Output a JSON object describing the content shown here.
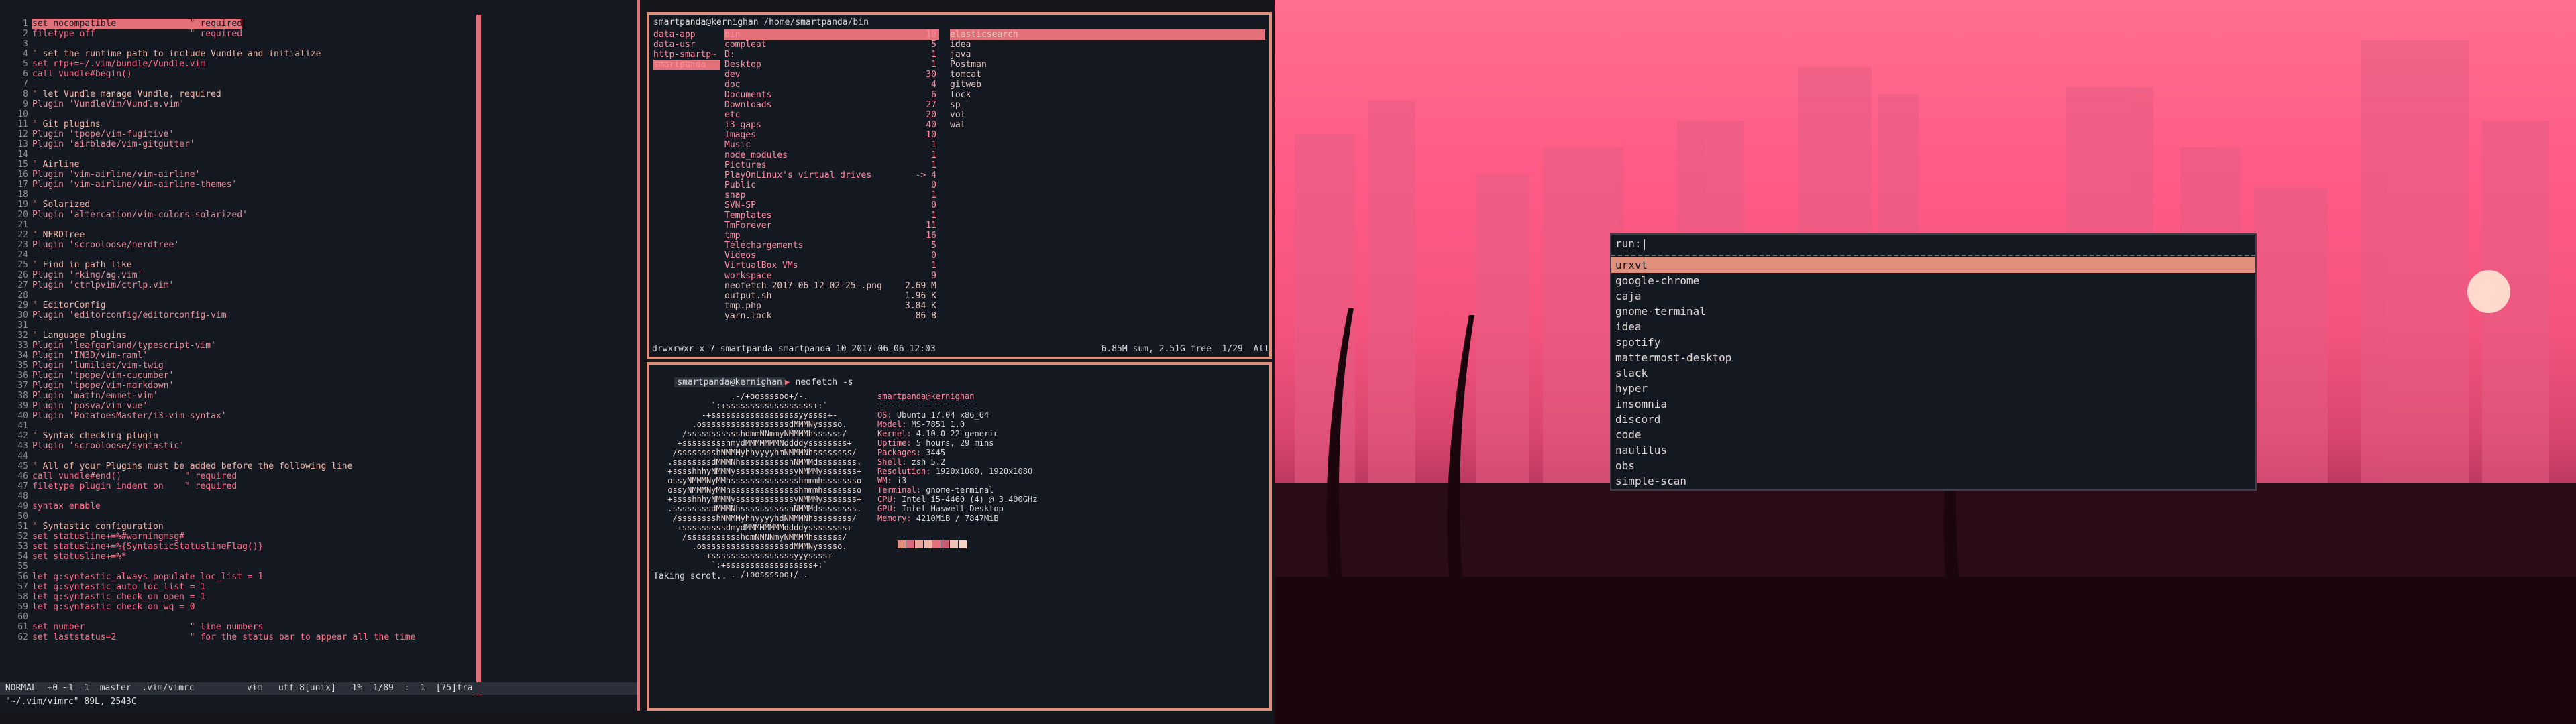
{
  "vim": {
    "lines": [
      {
        "n": "1",
        "t": "set nocompatible              \" required"
      },
      {
        "n": "2",
        "t": "filetype off                  \" required"
      },
      {
        "n": "3",
        "t": ""
      },
      {
        "n": "4",
        "t": "\" set the runtime path to include Vundle and initialize"
      },
      {
        "n": "5",
        "t": "set rtp+=~/.vim/bundle/Vundle.vim"
      },
      {
        "n": "6",
        "t": "call vundle#begin()"
      },
      {
        "n": "7",
        "t": ""
      },
      {
        "n": "8",
        "t": "\" let Vundle manage Vundle, required"
      },
      {
        "n": "9",
        "t": "Plugin 'VundleVim/Vundle.vim'"
      },
      {
        "n": "10",
        "t": ""
      },
      {
        "n": "11",
        "t": "\" Git plugins"
      },
      {
        "n": "12",
        "t": "Plugin 'tpope/vim-fugitive'"
      },
      {
        "n": "13",
        "t": "Plugin 'airblade/vim-gitgutter'"
      },
      {
        "n": "14",
        "t": ""
      },
      {
        "n": "15",
        "t": "\" Airline"
      },
      {
        "n": "16",
        "t": "Plugin 'vim-airline/vim-airline'"
      },
      {
        "n": "17",
        "t": "Plugin 'vim-airline/vim-airline-themes'"
      },
      {
        "n": "18",
        "t": ""
      },
      {
        "n": "19",
        "t": "\" Solarized"
      },
      {
        "n": "20",
        "t": "Plugin 'altercation/vim-colors-solarized'"
      },
      {
        "n": "21",
        "t": ""
      },
      {
        "n": "22",
        "t": "\" NERDTree"
      },
      {
        "n": "23",
        "t": "Plugin 'scrooloose/nerdtree'"
      },
      {
        "n": "24",
        "t": ""
      },
      {
        "n": "25",
        "t": "\" Find in path like"
      },
      {
        "n": "26",
        "t": "Plugin 'rking/ag.vim'"
      },
      {
        "n": "27",
        "t": "Plugin 'ctrlpvim/ctrlp.vim'"
      },
      {
        "n": "28",
        "t": ""
      },
      {
        "n": "29",
        "t": "\" EditorConfig"
      },
      {
        "n": "30",
        "t": "Plugin 'editorconfig/editorconfig-vim'"
      },
      {
        "n": "31",
        "t": ""
      },
      {
        "n": "32",
        "t": "\" Language plugins"
      },
      {
        "n": "33",
        "t": "Plugin 'leafgarland/typescript-vim'"
      },
      {
        "n": "34",
        "t": "Plugin 'IN3D/vim-raml'"
      },
      {
        "n": "35",
        "t": "Plugin 'lumiliet/vim-twig'"
      },
      {
        "n": "36",
        "t": "Plugin 'tpope/vim-cucumber'"
      },
      {
        "n": "37",
        "t": "Plugin 'tpope/vim-markdown'"
      },
      {
        "n": "38",
        "t": "Plugin 'mattn/emmet-vim'"
      },
      {
        "n": "39",
        "t": "Plugin 'posva/vim-vue'"
      },
      {
        "n": "40",
        "t": "Plugin 'PotatoesMaster/i3-vim-syntax'"
      },
      {
        "n": "41",
        "t": ""
      },
      {
        "n": "42",
        "t": "\" Syntax checking plugin"
      },
      {
        "n": "43",
        "t": "Plugin 'scrooloose/syntastic'"
      },
      {
        "n": "44",
        "t": ""
      },
      {
        "n": "45",
        "t": "\" All of your Plugins must be added before the following line"
      },
      {
        "n": "46",
        "t": "call vundle#end()            \" required"
      },
      {
        "n": "47",
        "t": "filetype plugin indent on    \" required"
      },
      {
        "n": "48",
        "t": ""
      },
      {
        "n": "49",
        "t": "syntax enable"
      },
      {
        "n": "50",
        "t": ""
      },
      {
        "n": "51",
        "t": "\" Syntastic configuration"
      },
      {
        "n": "52",
        "t": "set statusline+=%#warningmsg#"
      },
      {
        "n": "53",
        "t": "set statusline+=%{SyntasticStatuslineFlag()}"
      },
      {
        "n": "54",
        "t": "set statusline+=%*"
      },
      {
        "n": "55",
        "t": ""
      },
      {
        "n": "56",
        "t": "let g:syntastic_always_populate_loc_list = 1"
      },
      {
        "n": "57",
        "t": "let g:syntastic_auto_loc_list = 1"
      },
      {
        "n": "58",
        "t": "let g:syntastic_check_on_open = 1"
      },
      {
        "n": "59",
        "t": "let g:syntastic_check_on_wq = 0"
      },
      {
        "n": "60",
        "t": ""
      },
      {
        "n": "61",
        "t": "set number                    \" line numbers"
      },
      {
        "n": "62",
        "t": "set laststatus=2              \" for the status bar to appear all the time"
      }
    ],
    "status": " NORMAL  +0 ~1 -1  master  .vim/vimrc          vim   utf-8[unix]   1%  1/89  :  1  [75]tra",
    "cmdline": "\"~/.vim/vimrc\" 89L, 2543C"
  },
  "ranger": {
    "title": "smartpanda@kernighan /home/smartpanda/bin",
    "col1": [
      "data-app",
      "data-usr",
      "http-smartp~",
      "smartpanda"
    ],
    "col2": [
      {
        "name": "bin",
        "size": "10"
      },
      {
        "name": "compleat",
        "size": "5"
      },
      {
        "name": "D:",
        "size": "1"
      },
      {
        "name": "Desktop",
        "size": "1"
      },
      {
        "name": "dev",
        "size": "30"
      },
      {
        "name": "doc",
        "size": "4"
      },
      {
        "name": "Documents",
        "size": "6"
      },
      {
        "name": "Downloads",
        "size": "27"
      },
      {
        "name": "etc",
        "size": "20"
      },
      {
        "name": "i3-gaps",
        "size": "40"
      },
      {
        "name": "Images",
        "size": "10"
      },
      {
        "name": "Music",
        "size": "1"
      },
      {
        "name": "node_modules",
        "size": "1"
      },
      {
        "name": "Pictures",
        "size": "1"
      },
      {
        "name": "PlayOnLinux's virtual drives",
        "size": "-> 4"
      },
      {
        "name": "Public",
        "size": "0"
      },
      {
        "name": "snap",
        "size": "1"
      },
      {
        "name": "SVN-SP",
        "size": "0"
      },
      {
        "name": "Templates",
        "size": "1"
      },
      {
        "name": "TmForever",
        "size": "11"
      },
      {
        "name": "tmp",
        "size": "16"
      },
      {
        "name": "Téléchargements",
        "size": "5"
      },
      {
        "name": "Videos",
        "size": "0"
      },
      {
        "name": "VirtualBox VMs",
        "size": "1"
      },
      {
        "name": "workspace",
        "size": "9"
      },
      {
        "name": "neofetch-2017-06-12-02-25-.png",
        "size": "2.69 M"
      },
      {
        "name": "output.sh",
        "size": "1.96 K"
      },
      {
        "name": "tmp.php",
        "size": "3.84 K"
      },
      {
        "name": "yarn.lock",
        "size": "86 B"
      }
    ],
    "col3": [
      "elasticsearch",
      "idea",
      "java",
      "Postman",
      "tomcat",
      "gitweb",
      "lock",
      "sp",
      "vol",
      "wal"
    ],
    "footer_left": "drwxrwxr-x 7 smartpanda smartpanda 10 2017-06-06 12:03",
    "footer_right": "6.85M sum, 2.51G free  1/29  All"
  },
  "term": {
    "prompt_user": "smartpanda@kernighan",
    "prompt_cmd": "neofetch -s",
    "logo": [
      "              .-/+oossssoo+/-.",
      "          `:+ssssssssssssssssss+:`",
      "        -+ssssssssssssssssssyyssss+-",
      "      .ossssssssssssssssssdMMMNysssso.",
      "    /ssssssssssshdmmNNmmyNMMMMhssssss/",
      "   +ssssssssshmydMMMMMMMNddddyssssssss+",
      "  /sssssssshNMMMyhhyyyyhmNMMMNhssssssss/",
      " .ssssssssdMMMNhsssssssssshNMMMdssssssss.",
      " +sssshhhyNMMNyssssssssssssyNMMMysssssss+",
      " ossyNMMMNyMMhsssssssssssssshmmmhssssssso",
      " ossyNMMMNyMMhsssssssssssssshmmmhssssssso",
      " +sssshhhyNMMNyssssssssssssyNMMMysssssss+",
      " .ssssssssdMMMNhsssssssssshNMMMdssssssss.",
      "  /sssssssshNMMMyhhyyyyhdNMMMNhssssssss/",
      "   +sssssssssdmydMMMMMMMMddddyssssssss+",
      "    /ssssssssssshdmNNNNmyNMMMMhssssss/",
      "      .ossssssssssssssssssdMMMNysssso.",
      "        -+sssssssssssssssssyyyssss+-",
      "          `:+ssssssssssssssssss+:`",
      "              .-/+oossssoo+/-."
    ],
    "info": [
      {
        "k": "",
        "v": "smartpanda@kernighan"
      },
      {
        "k": "",
        "v": "--------------------"
      },
      {
        "k": "OS:",
        "v": " Ubuntu 17.04 x86_64"
      },
      {
        "k": "Model:",
        "v": " MS-7851 1.0"
      },
      {
        "k": "Kernel:",
        "v": " 4.10.0-22-generic"
      },
      {
        "k": "Uptime:",
        "v": " 5 hours, 29 mins"
      },
      {
        "k": "Packages:",
        "v": " 3445"
      },
      {
        "k": "Shell:",
        "v": " zsh 5.2"
      },
      {
        "k": "Resolution:",
        "v": " 1920x1080, 1920x1080"
      },
      {
        "k": "WM:",
        "v": " i3"
      },
      {
        "k": "Terminal:",
        "v": " gnome-terminal"
      },
      {
        "k": "CPU:",
        "v": " Intel i5-4460 (4) @ 3.400GHz"
      },
      {
        "k": "GPU:",
        "v": " Intel Haswell Desktop"
      },
      {
        "k": "Memory:",
        "v": " 4210MiB / 7847MiB"
      }
    ],
    "swatches": [
      "#e0907a",
      "#d86a7d",
      "#e8a59a",
      "#f0b5a6",
      "#e4707a",
      "#c75d73",
      "#efc2b6",
      "#f6d2c4"
    ],
    "last_line": "Taking scrot.."
  },
  "dmenu": {
    "prompt": "run:",
    "options": [
      "urxvt",
      "google-chrome",
      "caja",
      "gnome-terminal",
      "idea",
      "spotify",
      "mattermost-desktop",
      "slack",
      "hyper",
      "insomnia",
      "discord",
      "code",
      "nautilus",
      "obs",
      "simple-scan"
    ]
  }
}
